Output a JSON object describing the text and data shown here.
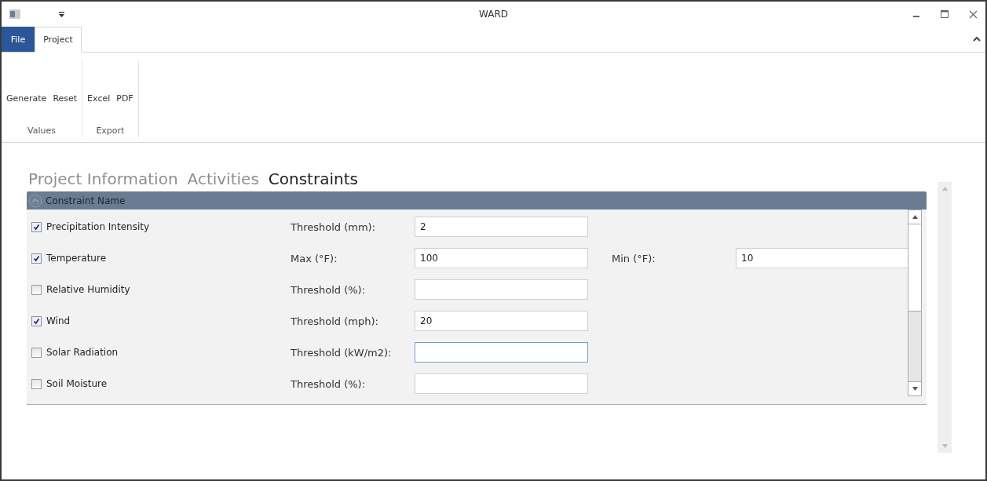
{
  "window": {
    "title": "WARD"
  },
  "ribbon_tabs": [
    {
      "label": "File",
      "kind": "file",
      "selected": false
    },
    {
      "label": "Project",
      "kind": "tab",
      "selected": true
    }
  ],
  "ribbon_groups": [
    {
      "label": "Values",
      "buttons": [
        "Generate",
        "Reset"
      ]
    },
    {
      "label": "Export",
      "buttons": [
        "Excel",
        "PDF"
      ]
    }
  ],
  "section_tabs": [
    {
      "label": "Project Information",
      "selected": false
    },
    {
      "label": "Activities",
      "selected": false
    },
    {
      "label": "Constraints",
      "selected": true
    }
  ],
  "group_header": {
    "label": "Constraint Name",
    "expanded": true
  },
  "constraints": [
    {
      "name": "Precipitation Intensity",
      "checked": true,
      "fields": [
        {
          "label": "Threshold (mm):",
          "value": "2"
        }
      ]
    },
    {
      "name": "Temperature",
      "checked": true,
      "fields": [
        {
          "label": "Max (°F):",
          "value": "100"
        },
        {
          "label": "Min (°F):",
          "value": "10"
        }
      ]
    },
    {
      "name": "Relative Humidity",
      "checked": false,
      "fields": [
        {
          "label": "Threshold (%):"
        }
      ]
    },
    {
      "name": "Wind",
      "checked": true,
      "fields": [
        {
          "label": "Threshold (mph):",
          "value": "20"
        }
      ]
    },
    {
      "name": "Solar Radiation",
      "checked": false,
      "fields": [
        {
          "label": "Threshold (kW/m2):",
          "focused": true
        }
      ]
    },
    {
      "name": "Soil Moisture",
      "checked": false,
      "fields": [
        {
          "label": "Threshold (%):"
        }
      ]
    }
  ]
}
